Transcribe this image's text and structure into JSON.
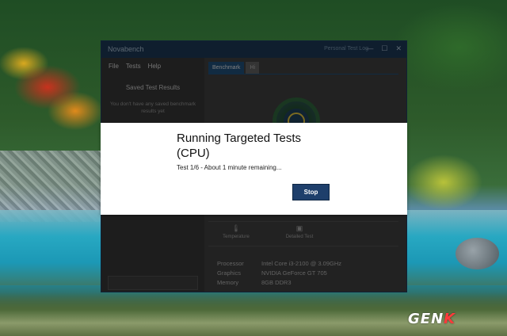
{
  "app": {
    "title": "Novabench",
    "title_right": "Personal Test Log",
    "window_controls": [
      "—",
      "☐",
      "✕"
    ]
  },
  "menu": [
    "File",
    "Tests",
    "Help"
  ],
  "sidebar": {
    "saved_title": "Saved Test Results",
    "empty_message": "You don't have any saved benchmark results yet"
  },
  "tabs": [
    {
      "label": "Benchmark",
      "active": true
    },
    {
      "label": "Hi",
      "active": false
    }
  ],
  "tools": [
    {
      "label": "Temperature",
      "icon": "thermometer-icon"
    },
    {
      "label": "Detailed Test",
      "icon": "test-icon"
    }
  ],
  "specs": [
    {
      "label": "Processor",
      "value": "Intel Core i3-2100 @ 3.09GHz"
    },
    {
      "label": "Graphics",
      "value": "NVIDIA GeForce GT 705"
    },
    {
      "label": "Memory",
      "value": "8GB DDR3"
    }
  ],
  "modal": {
    "heading_line1": "Running Targeted Tests",
    "heading_line2": "(CPU)",
    "status": "Test 1/6 - About 1 minute remaining...",
    "stop_label": "Stop"
  },
  "watermark": {
    "main": "GEN",
    "accent": "K"
  },
  "colors": {
    "titlebar": "#1a3550",
    "accent_blue": "#1e3f6b",
    "tab_active": "#1e4a72"
  }
}
